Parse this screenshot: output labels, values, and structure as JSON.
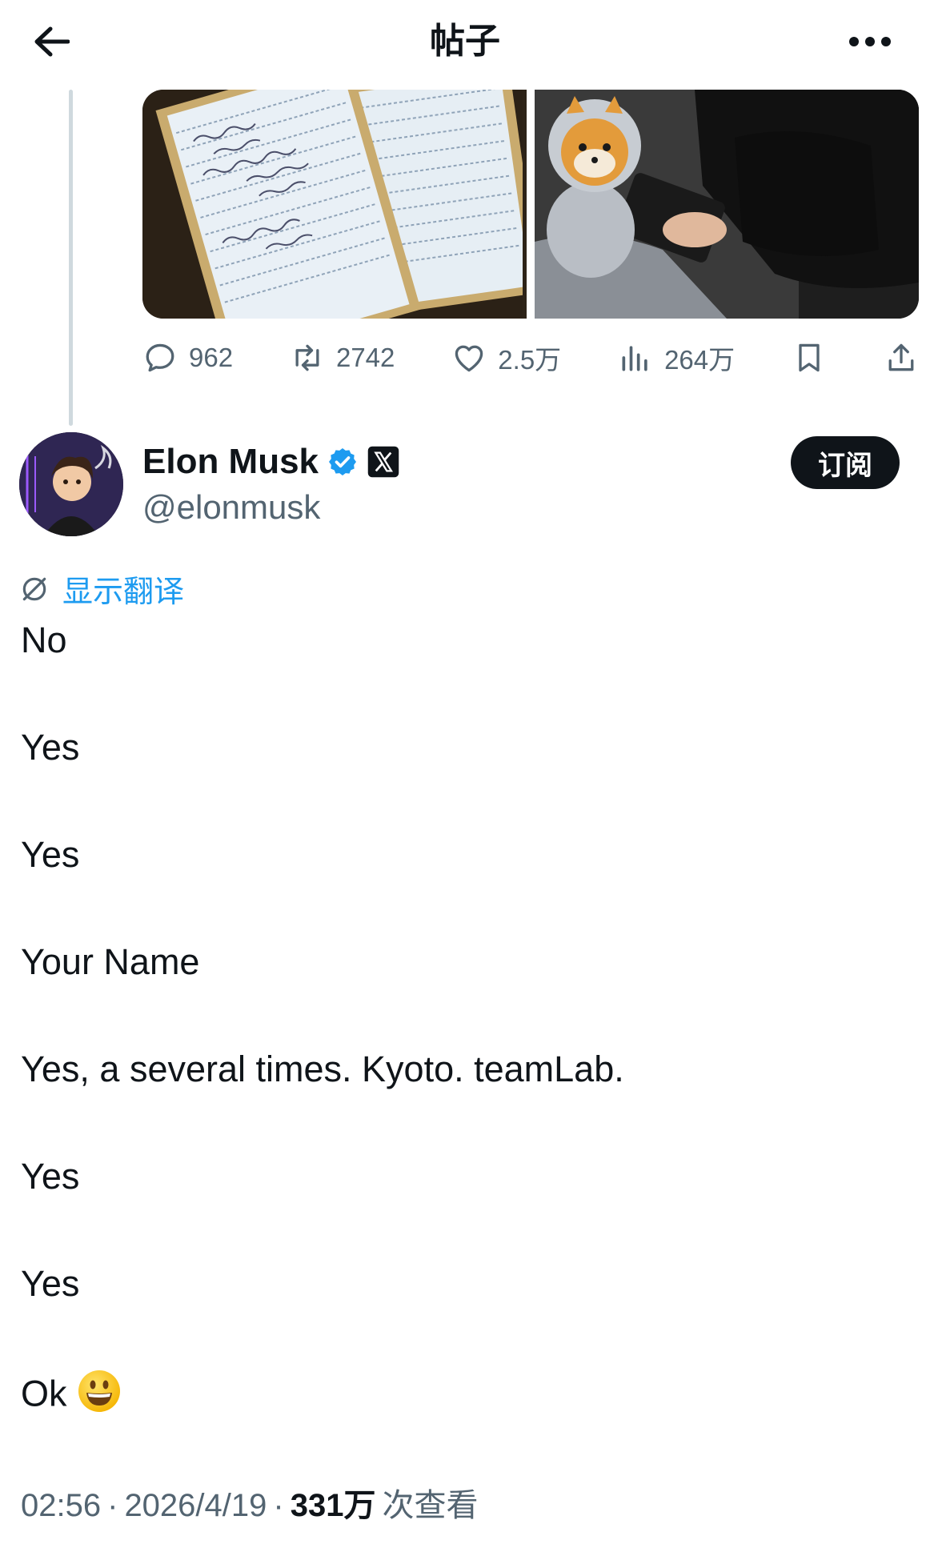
{
  "header": {
    "title": "帖子"
  },
  "stats": {
    "replies": "962",
    "reposts": "2742",
    "likes": "2.5万",
    "views": "264万"
  },
  "author": {
    "name": "Elon Musk",
    "handle": "@elonmusk",
    "verified_color": "#1d9bf0"
  },
  "subscribe_label": "订阅",
  "translate_label": "显示翻译",
  "tweet_lines": [
    "No",
    "Yes",
    "Yes",
    "Your Name",
    "Yes, a several times. Kyoto. teamLab.",
    "Yes",
    "Yes",
    "Ok"
  ],
  "meta": {
    "time": "02:56",
    "date": "2026/4/19",
    "views_count": "331万",
    "views_suffix": "次查看"
  },
  "icons": {
    "back": "arrow-left-icon",
    "more": "more-horizontal-icon",
    "reply": "reply-icon",
    "repost": "repost-icon",
    "like": "heart-icon",
    "views": "bar-chart-icon",
    "bookmark": "bookmark-icon",
    "share": "share-icon",
    "translate": "translate-icon",
    "emoji": "grinning-face-emoji"
  },
  "colors": {
    "accent": "#1d9bf0",
    "text": "#0f1419",
    "muted": "#536471"
  }
}
